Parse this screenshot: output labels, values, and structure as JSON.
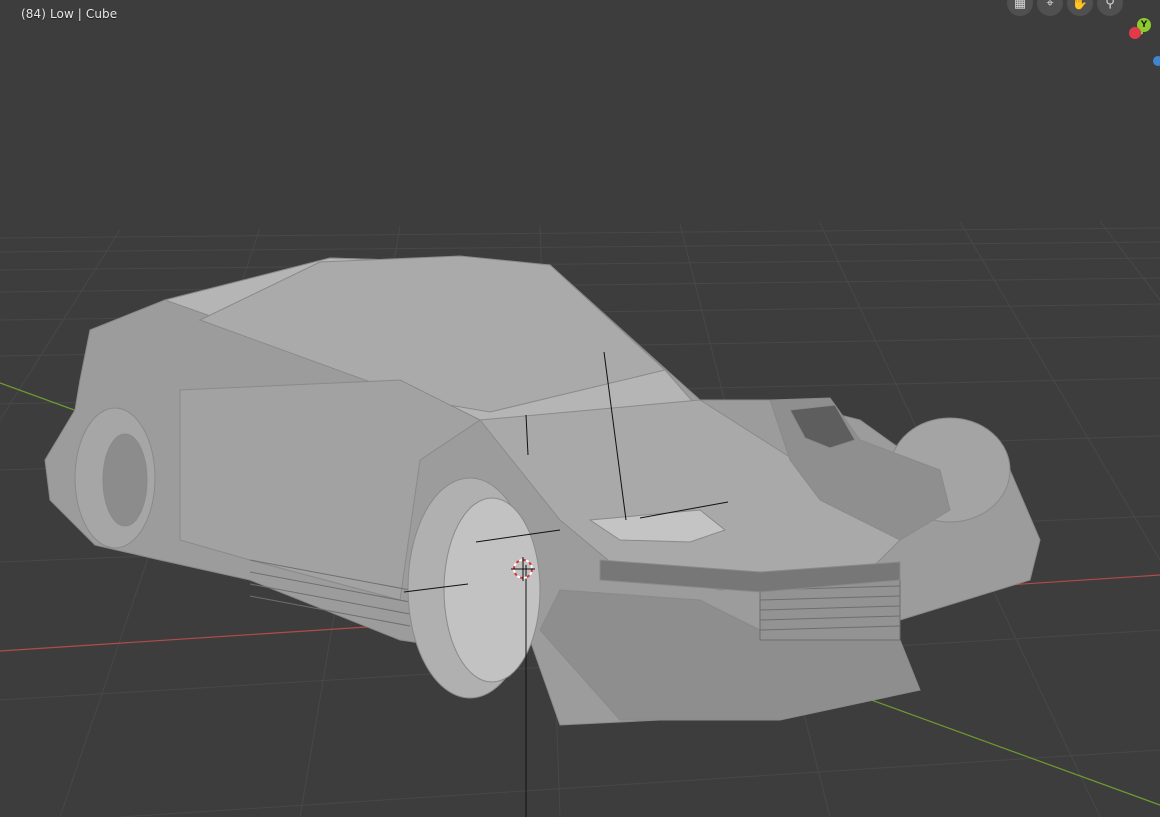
{
  "viewport": {
    "overlay_text": "(84) Low | Cube",
    "background_color": "#3d3d3d",
    "grid_color": "#4a4a4a",
    "x_axis_color": "#b34a4a",
    "y_axis_color": "#6f9c31"
  },
  "navigation": {
    "buttons": [
      {
        "name": "grid-view-icon",
        "glyph": "▦"
      },
      {
        "name": "camera-view-icon",
        "glyph": "⌖"
      },
      {
        "name": "pan-hand-icon",
        "glyph": "✋"
      },
      {
        "name": "zoom-icon",
        "glyph": "⚲"
      }
    ]
  },
  "gizmo": {
    "y_label": "Y",
    "x_color": "#e23a4b",
    "y_color": "#8bcc2c",
    "z_color": "#3e86d4"
  }
}
